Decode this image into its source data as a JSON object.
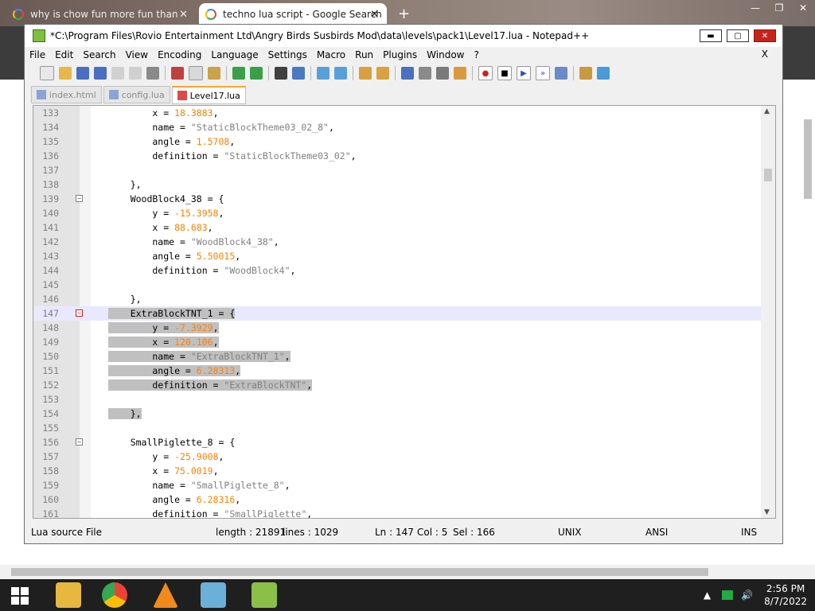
{
  "browser": {
    "tabs": [
      {
        "title": "why is chow fun more fun than"
      },
      {
        "title": "techno lua script - Google Search"
      }
    ]
  },
  "npp": {
    "title": "*C:\\Program Files\\Rovio Entertainment Ltd\\Angry Birds Susbirds Mod\\data\\levels\\pack1\\Level17.lua - Notepad++",
    "menu": [
      "File",
      "Edit",
      "Search",
      "View",
      "Encoding",
      "Language",
      "Settings",
      "Macro",
      "Run",
      "Plugins",
      "Window",
      "?"
    ],
    "menu_close": "X",
    "file_tabs": [
      {
        "name": "index.html"
      },
      {
        "name": "config.lua"
      },
      {
        "name": "Level17.lua"
      }
    ],
    "status": {
      "file_type": "Lua source File",
      "length": "length : 21891",
      "lines": "lines : 1029",
      "ln": "Ln : 147",
      "col": "Col : 5",
      "sel": "Sel : 166",
      "eol": "UNIX",
      "encoding": "ANSI",
      "mode": "INS"
    }
  },
  "code_lines": [
    {
      "n": "133",
      "pre": "        x = ",
      "num": "18.3883",
      "post": ","
    },
    {
      "n": "134",
      "pre": "        name = ",
      "str": "\"StaticBlockTheme03_02_8\"",
      "post": ","
    },
    {
      "n": "135",
      "pre": "        angle = ",
      "num": "1.5708",
      "post": ","
    },
    {
      "n": "136",
      "pre": "        definition = ",
      "str": "\"StaticBlockTheme03_02\"",
      "post": ","
    },
    {
      "n": "137",
      "pre": ""
    },
    {
      "n": "138",
      "pre": "    },"
    },
    {
      "n": "139",
      "pre": "    WoodBlock4_38 = {"
    },
    {
      "n": "140",
      "pre": "        y = ",
      "num": "-15.3958",
      "post": ","
    },
    {
      "n": "141",
      "pre": "        x = ",
      "num": "88.683",
      "post": ","
    },
    {
      "n": "142",
      "pre": "        name = ",
      "str": "\"WoodBlock4_38\"",
      "post": ","
    },
    {
      "n": "143",
      "pre": "        angle = ",
      "num": "5.50015",
      "post": ","
    },
    {
      "n": "144",
      "pre": "        definition = ",
      "str": "\"WoodBlock4\"",
      "post": ","
    },
    {
      "n": "145",
      "pre": ""
    },
    {
      "n": "146",
      "pre": "    },"
    },
    {
      "n": "147",
      "pre": "    ExtraBlockTNT_1 = {"
    },
    {
      "n": "148",
      "pre": "        y = ",
      "num": "-7.3929",
      "post": ","
    },
    {
      "n": "149",
      "pre": "        x = ",
      "num": "120.106",
      "post": ","
    },
    {
      "n": "150",
      "pre": "        name = ",
      "str": "\"ExtraBlockTNT_1\"",
      "post": ","
    },
    {
      "n": "151",
      "pre": "        angle = ",
      "num": "6.28313",
      "post": ","
    },
    {
      "n": "152",
      "pre": "        definition = ",
      "str": "\"ExtraBlockTNT\"",
      "post": ","
    },
    {
      "n": "153",
      "pre": ""
    },
    {
      "n": "154",
      "pre": "    },"
    },
    {
      "n": "155",
      "pre": ""
    },
    {
      "n": "156",
      "pre": "    SmallPiglette_8 = {"
    },
    {
      "n": "157",
      "pre": "        y = ",
      "num": "-25.9008",
      "post": ","
    },
    {
      "n": "158",
      "pre": "        x = ",
      "num": "75.0019",
      "post": ","
    },
    {
      "n": "159",
      "pre": "        name = ",
      "str": "\"SmallPiglette_8\"",
      "post": ","
    },
    {
      "n": "160",
      "pre": "        angle = ",
      "num": "6.28316",
      "post": ","
    },
    {
      "n": "161",
      "pre": "        definition = ",
      "str": "\"SmallPiglette\"",
      "post": ","
    }
  ],
  "taskbar": {
    "time": "2:56 PM",
    "date": "8/7/2022"
  }
}
